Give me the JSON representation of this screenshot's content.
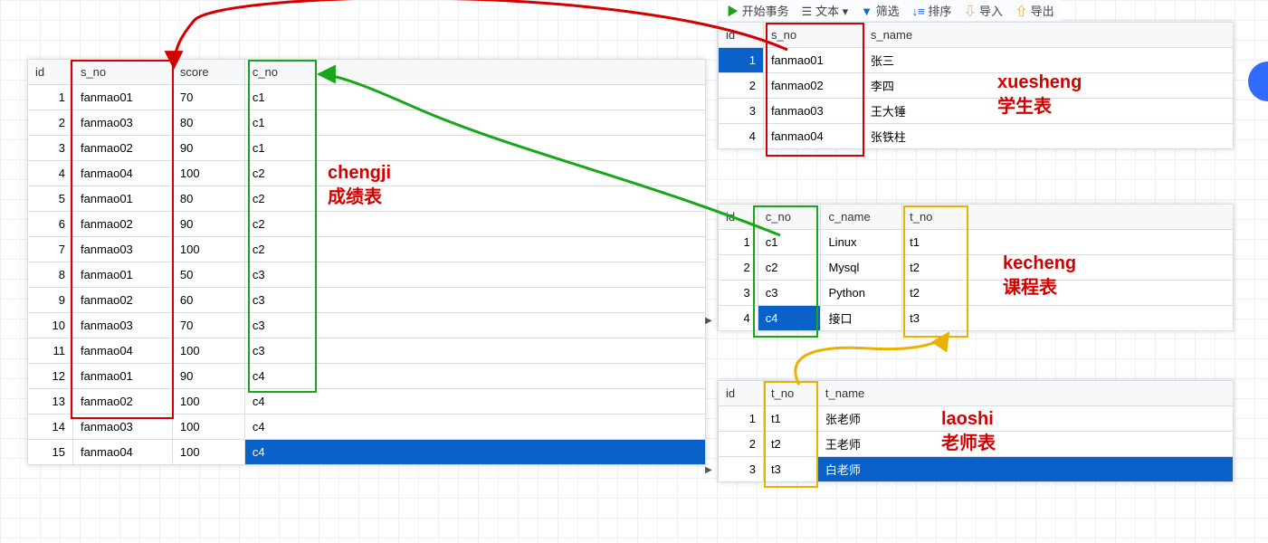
{
  "toolbar": {
    "start": "开始事务",
    "text": "文本",
    "filter": "筛选",
    "sort": "排序",
    "import": "导入",
    "export": "导出"
  },
  "labels": {
    "chengji": "chengji\n成绩表",
    "xuesheng": "xuesheng\n学生表",
    "kecheng": "kecheng\n课程表",
    "laoshi": "laoshi\n老师表"
  },
  "chengji": {
    "headers": [
      "id",
      "s_no",
      "score",
      "c_no"
    ],
    "rows": [
      [
        "1",
        "fanmao01",
        "70",
        "c1"
      ],
      [
        "2",
        "fanmao03",
        "80",
        "c1"
      ],
      [
        "3",
        "fanmao02",
        "90",
        "c1"
      ],
      [
        "4",
        "fanmao04",
        "100",
        "c2"
      ],
      [
        "5",
        "fanmao01",
        "80",
        "c2"
      ],
      [
        "6",
        "fanmao02",
        "90",
        "c2"
      ],
      [
        "7",
        "fanmao03",
        "100",
        "c2"
      ],
      [
        "8",
        "fanmao01",
        "50",
        "c3"
      ],
      [
        "9",
        "fanmao02",
        "60",
        "c3"
      ],
      [
        "10",
        "fanmao03",
        "70",
        "c3"
      ],
      [
        "11",
        "fanmao04",
        "100",
        "c3"
      ],
      [
        "12",
        "fanmao01",
        "90",
        "c4"
      ],
      [
        "13",
        "fanmao02",
        "100",
        "c4"
      ],
      [
        "14",
        "fanmao03",
        "100",
        "c4"
      ],
      [
        "15",
        "fanmao04",
        "100",
        "c4"
      ]
    ],
    "selected_cell": {
      "row": 14,
      "col": 3
    }
  },
  "xuesheng": {
    "headers": [
      "id",
      "s_no",
      "s_name"
    ],
    "rows": [
      [
        "1",
        "fanmao01",
        "张三"
      ],
      [
        "2",
        "fanmao02",
        "李四"
      ],
      [
        "3",
        "fanmao03",
        "王大锤"
      ],
      [
        "4",
        "fanmao04",
        "张铁柱"
      ]
    ],
    "selected_cell": {
      "row": 0,
      "col": 0
    }
  },
  "kecheng": {
    "headers": [
      "id",
      "c_no",
      "c_name",
      "t_no"
    ],
    "rows": [
      [
        "1",
        "c1",
        "Linux",
        "t1"
      ],
      [
        "2",
        "c2",
        "Mysql",
        "t2"
      ],
      [
        "3",
        "c3",
        "Python",
        "t2"
      ],
      [
        "4",
        "c4",
        "接口",
        "t3"
      ]
    ],
    "selected_cell": {
      "row": 3,
      "col": 1
    }
  },
  "laoshi": {
    "headers": [
      "id",
      "t_no",
      "t_name"
    ],
    "rows": [
      [
        "1",
        "t1",
        "张老师"
      ],
      [
        "2",
        "t2",
        "王老师"
      ],
      [
        "3",
        "t3",
        "白老师"
      ]
    ],
    "selected_cell": {
      "row": 2,
      "col": 2
    }
  }
}
